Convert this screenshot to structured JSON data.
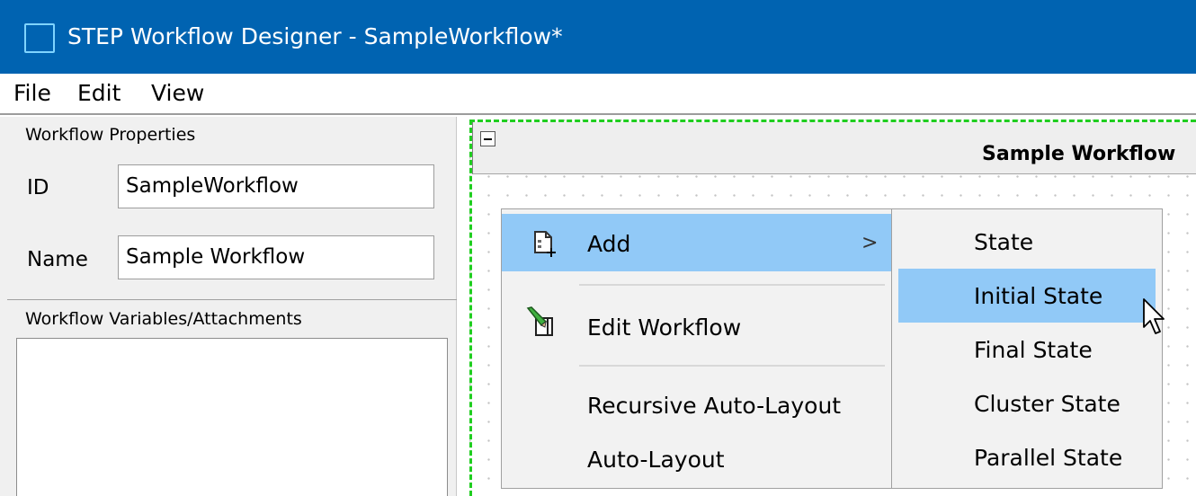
{
  "window": {
    "title": "STEP Workflow Designer - SampleWorkflow*"
  },
  "menubar": {
    "items": [
      "File",
      "Edit",
      "View"
    ]
  },
  "properties": {
    "section_title": "Workflow Properties",
    "id_label": "ID",
    "id_value": "SampleWorkflow",
    "name_label": "Name",
    "name_value": "Sample Workflow"
  },
  "variables": {
    "section_title": "Workflow Variables/Attachments"
  },
  "canvas": {
    "workflow_title": "Sample Workflow"
  },
  "context_menu": {
    "add_label": "Add",
    "add_arrow": ">",
    "edit_label": "Edit Workflow",
    "recursive_label": "Recursive Auto-Layout",
    "auto_label": "Auto-Layout"
  },
  "submenu": {
    "items": [
      "State",
      "Initial State",
      "Final State",
      "Cluster State",
      "Parallel State"
    ],
    "highlighted": "Initial State"
  },
  "colors": {
    "titlebar": "#0063b1",
    "highlight": "#91c9f7",
    "selection_border": "#1fce1f"
  },
  "icons": [
    "app-window-icon",
    "collapse-icon",
    "add-document-icon",
    "edit-workflow-icon",
    "mouse-cursor-icon"
  ]
}
